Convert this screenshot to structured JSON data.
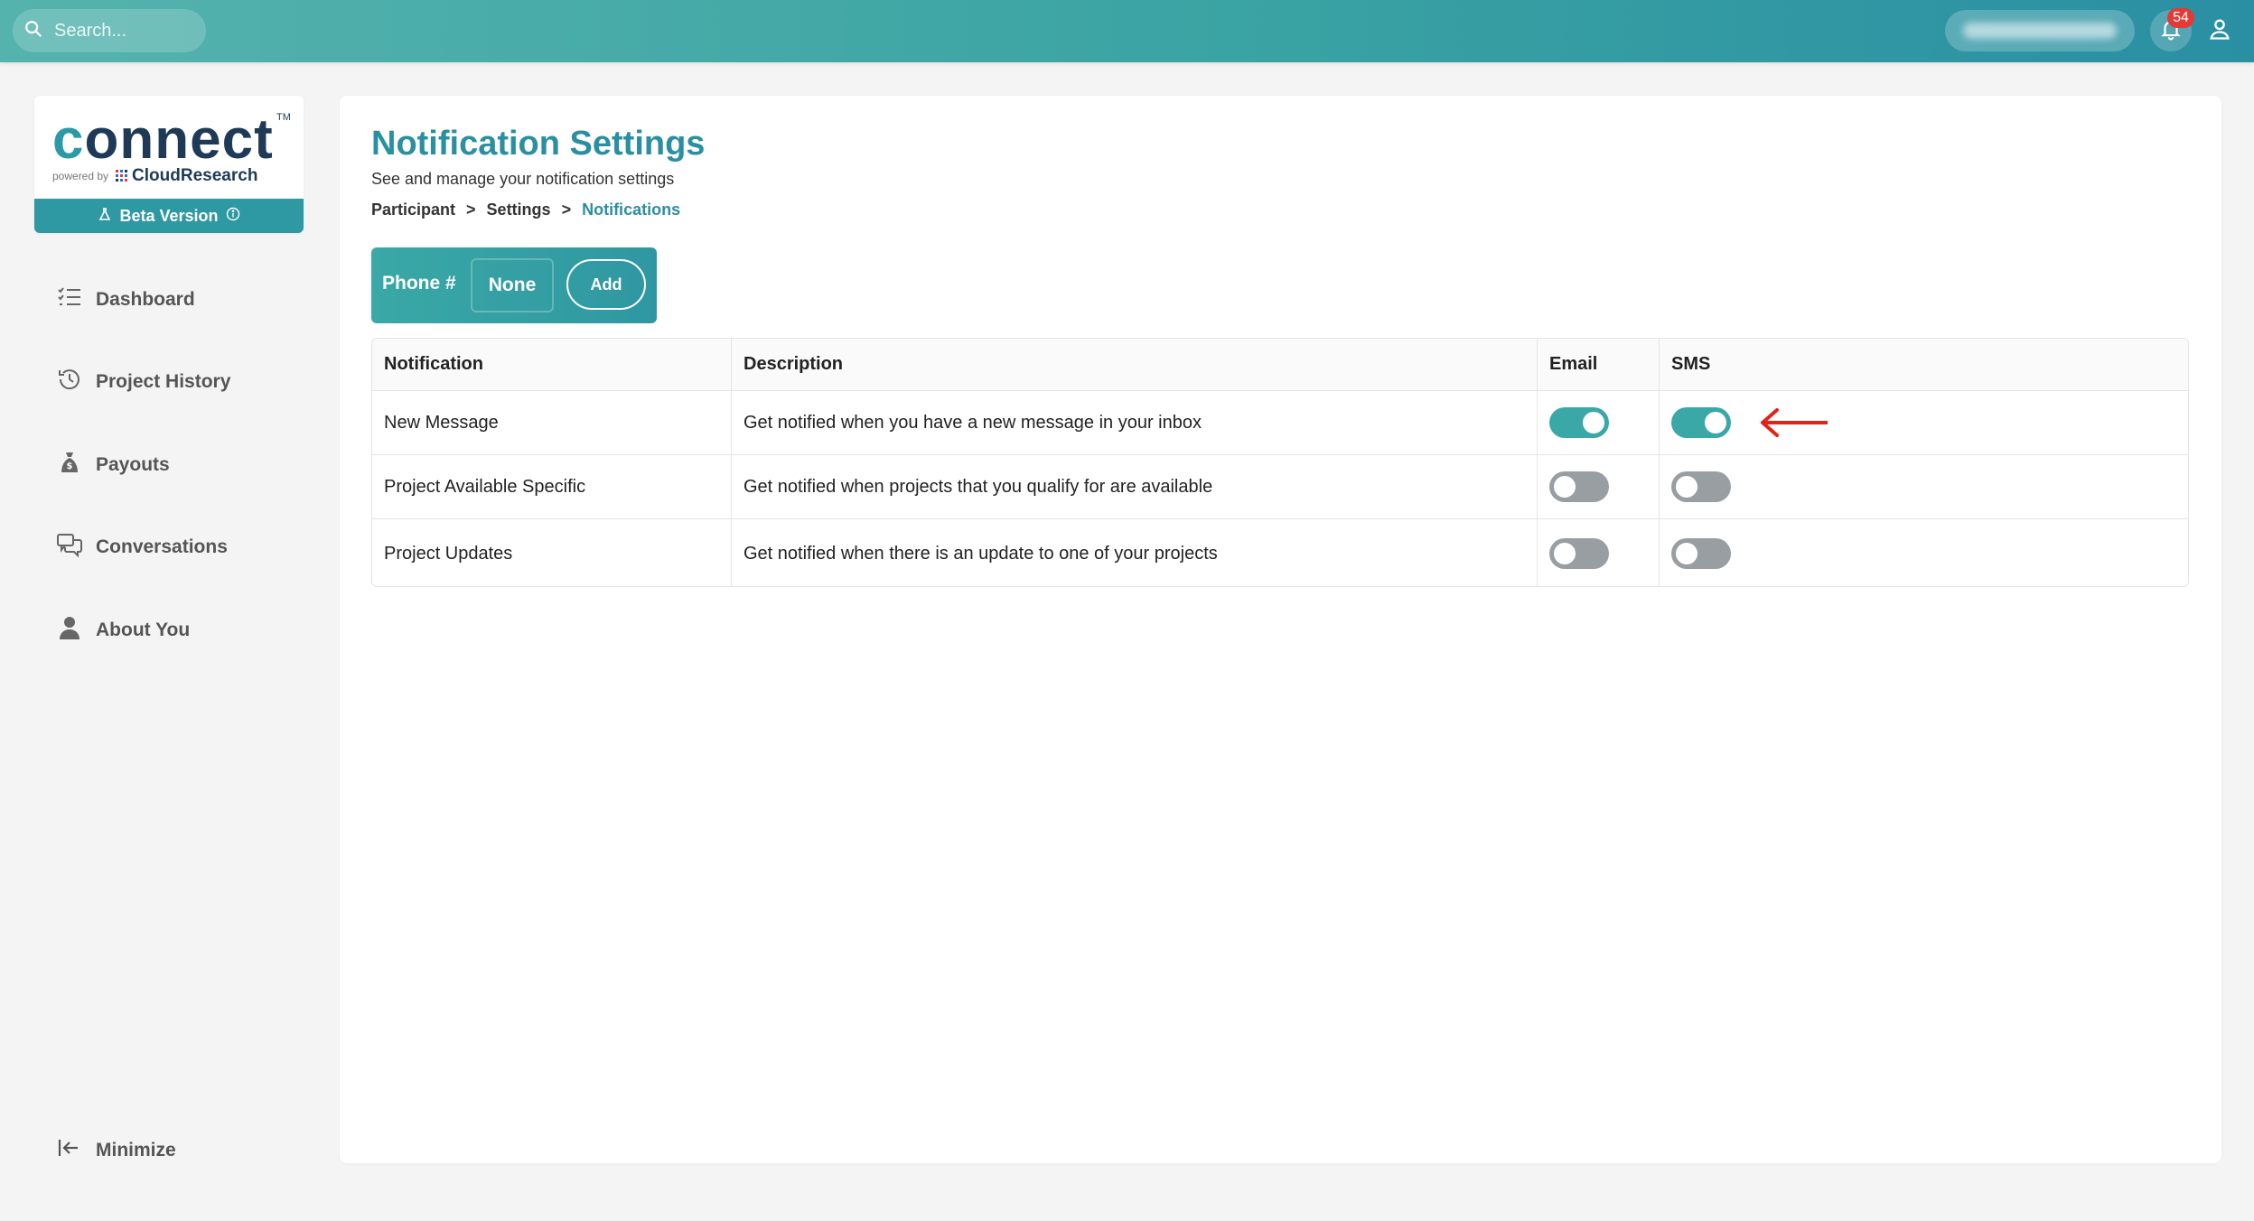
{
  "search": {
    "placeholder": "Search..."
  },
  "header": {
    "notification_count": "54"
  },
  "logo": {
    "brand": "connect",
    "tm": "TM",
    "powered_by": "powered by",
    "company": "CloudResearch",
    "beta_label": "Beta Version"
  },
  "sidebar": {
    "items": [
      {
        "label": "Dashboard",
        "icon": "list-check-icon"
      },
      {
        "label": "Project History",
        "icon": "history-icon"
      },
      {
        "label": "Payouts",
        "icon": "money-bag-icon"
      },
      {
        "label": "Conversations",
        "icon": "chat-bubbles-icon"
      },
      {
        "label": "About You",
        "icon": "user-icon"
      }
    ],
    "minimize_label": "Minimize"
  },
  "page": {
    "title": "Notification Settings",
    "subtitle": "See and manage your notification settings",
    "breadcrumb": [
      "Participant",
      "Settings",
      "Notifications"
    ],
    "breadcrumb_sep": ">"
  },
  "phone": {
    "label": "Phone #",
    "value": "None",
    "add_label": "Add"
  },
  "table": {
    "columns": [
      "Notification",
      "Description",
      "Email",
      "SMS"
    ],
    "rows": [
      {
        "notification": "New Message",
        "description": "Get notified when you have a new message in your inbox",
        "email": true,
        "sms": true
      },
      {
        "notification": "Project Available Specific",
        "description": "Get notified when projects that you qualify for are available",
        "email": false,
        "sms": false
      },
      {
        "notification": "Project Updates",
        "description": "Get notified when there is an update to one of your projects",
        "email": false,
        "sms": false
      }
    ]
  },
  "colors": {
    "accent": "#2a8fa0",
    "toggle_on": "#3aa8a6",
    "toggle_off": "#999ea3",
    "annotation_arrow": "#e0241b",
    "badge": "#e53935"
  }
}
